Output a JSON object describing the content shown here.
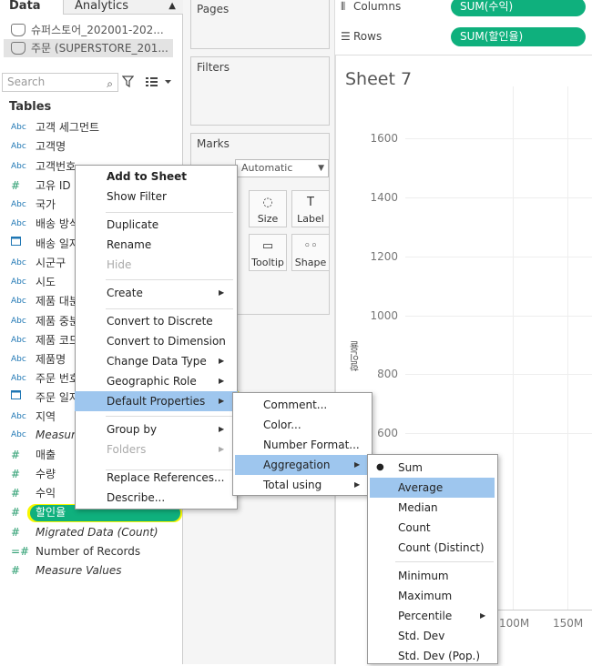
{
  "tabs": {
    "data": "Data",
    "analytics": "Analytics",
    "analytics_arrow": "▲"
  },
  "datasources": [
    {
      "label": "슈퍼스토어_202001-202..."
    },
    {
      "label": "주문 (SUPERSTORE_201..."
    }
  ],
  "search": {
    "placeholder": "Search"
  },
  "tables_header": "Tables",
  "fields": [
    {
      "icon": "Abc",
      "label": "고객 세그먼트"
    },
    {
      "icon": "Abc",
      "label": "고객명"
    },
    {
      "icon": "Abc",
      "label": "고객번호"
    },
    {
      "icon": "#",
      "label": "고유 ID"
    },
    {
      "icon": "Abc",
      "label": "국가"
    },
    {
      "icon": "Abc",
      "label": "배송 방식"
    },
    {
      "icon": "cal",
      "label": "배송 일자"
    },
    {
      "icon": "Abc",
      "label": "시군구"
    },
    {
      "icon": "Abc",
      "label": "시도"
    },
    {
      "icon": "Abc",
      "label": "제품 대분류"
    },
    {
      "icon": "Abc",
      "label": "제품 중분류"
    },
    {
      "icon": "Abc",
      "label": "제품 코드"
    },
    {
      "icon": "Abc",
      "label": "제품명"
    },
    {
      "icon": "Abc",
      "label": "주문 번호"
    },
    {
      "icon": "cal",
      "label": "주문 일자"
    },
    {
      "icon": "Abc",
      "label": "지역"
    },
    {
      "icon": "Abc",
      "label": "Measure Names"
    },
    {
      "icon": "#",
      "label": "매출"
    },
    {
      "icon": "#",
      "label": "수량"
    },
    {
      "icon": "#",
      "label": "수익"
    },
    {
      "icon": "#",
      "label": "할인율"
    },
    {
      "icon": "#",
      "label": "Migrated Data (Count)"
    },
    {
      "icon": "=#",
      "label": "Number of Records"
    },
    {
      "icon": "#",
      "label": "Measure Values"
    }
  ],
  "cards": {
    "pages": "Pages",
    "filters": "Filters",
    "marks": "Marks",
    "mark_type": "Automatic"
  },
  "mark_buttons": [
    {
      "label": "Size",
      "glyph": "◌"
    },
    {
      "label": "Label",
      "glyph": "T"
    },
    {
      "label": "Tooltip",
      "glyph": "▭"
    },
    {
      "label": "Shape",
      "glyph": "◦◦"
    }
  ],
  "shelves": {
    "columns_label": "Columns",
    "columns_pill": "SUM(수익)",
    "rows_label": "Rows",
    "rows_pill": "SUM(할인율)"
  },
  "sheet": {
    "title": "Sheet 7",
    "y_ticks": [
      "1600",
      "1400",
      "1200",
      "1000",
      "800",
      "600"
    ],
    "x_ticks": [
      "100M",
      "150M"
    ],
    "y_label": "할인율"
  },
  "context_menu": {
    "items": [
      {
        "label": "Add to Sheet"
      },
      {
        "label": "Show Filter"
      },
      {
        "label": "Duplicate"
      },
      {
        "label": "Rename"
      },
      {
        "label": "Hide"
      },
      {
        "label": "Create"
      },
      {
        "label": "Convert to Discrete"
      },
      {
        "label": "Convert to Dimension"
      },
      {
        "label": "Change Data Type"
      },
      {
        "label": "Geographic Role"
      },
      {
        "label": "Default Properties"
      },
      {
        "label": "Group by"
      },
      {
        "label": "Folders"
      },
      {
        "label": "Replace References..."
      },
      {
        "label": "Describe..."
      }
    ]
  },
  "submenu_default_properties": [
    {
      "label": "Comment..."
    },
    {
      "label": "Color..."
    },
    {
      "label": "Number Format..."
    },
    {
      "label": "Aggregation"
    },
    {
      "label": "Total using"
    }
  ],
  "submenu_aggregation": [
    {
      "label": "Sum",
      "checked": true
    },
    {
      "label": "Average"
    },
    {
      "label": "Median"
    },
    {
      "label": "Count"
    },
    {
      "label": "Count (Distinct)"
    },
    {
      "label": "Minimum"
    },
    {
      "label": "Maximum"
    },
    {
      "label": "Percentile"
    },
    {
      "label": "Std. Dev"
    },
    {
      "label": "Std. Dev (Pop.)"
    }
  ],
  "colors": {
    "pill": "#0fb07d",
    "menu_highlight": "#9ec6ee",
    "highlighter": "#f7f700"
  }
}
